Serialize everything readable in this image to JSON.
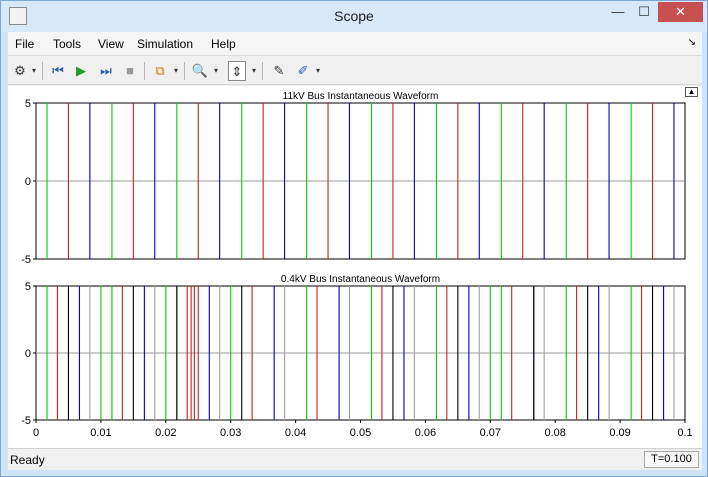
{
  "window": {
    "title": "Scope",
    "min_glyph": "—",
    "max_glyph": "☐",
    "close_glyph": "✕"
  },
  "menu": {
    "items": [
      "File",
      "Tools",
      "View",
      "Simulation",
      "Help"
    ],
    "arrow_glyph": "↘"
  },
  "toolbar": {
    "icons": [
      "gear-icon",
      "rewind-icon",
      "run-icon",
      "step-forward-icon",
      "stop-icon",
      "signal-select-icon",
      "zoom-icon",
      "scale-axes-icon",
      "highlight-icon",
      "edit-style-icon"
    ],
    "glyphs": {
      "gear": "⚙",
      "rewind": "⏮",
      "run": "▶",
      "step": "⏭",
      "stop": "■",
      "signal": "⧉",
      "zoom": "🔍",
      "scale": "⇕",
      "highlight": "✎",
      "edit": "✐",
      "drop": "▾"
    }
  },
  "status": {
    "left": "Ready",
    "right": "T=0.100"
  },
  "colors": {
    "blue": "#0000c8",
    "red": "#c8201a",
    "green": "#00d000",
    "gray": "#a0a0a0",
    "black": "#000000"
  },
  "chart_data": [
    {
      "type": "line",
      "title": "11kV Bus Instantaneous Waveform",
      "xlim": [
        0,
        0.1
      ],
      "ylim": [
        -5,
        5
      ],
      "yticks": [
        "5",
        "0",
        "-5"
      ],
      "xticks": [],
      "grid": "center-line",
      "series": [
        {
          "color": "green",
          "x": [
            0.0017,
            0.0117,
            0.0217,
            0.0317,
            0.0417,
            0.0517,
            0.0617,
            0.0717,
            0.0817,
            0.0917
          ]
        },
        {
          "color": "red",
          "x": [
            0.005,
            0.015,
            0.025,
            0.035,
            0.045,
            0.055,
            0.065,
            0.075,
            0.085,
            0.095
          ]
        },
        {
          "color": "blue",
          "x": [
            0.0083,
            0.0183,
            0.0283,
            0.0383,
            0.0483,
            0.0583,
            0.0683,
            0.0783,
            0.0883,
            0.0983
          ]
        }
      ]
    },
    {
      "type": "line",
      "title": "0.4kV Bus Instantaneous Waveform",
      "xlim": [
        0,
        0.1
      ],
      "ylim": [
        -5,
        5
      ],
      "yticks": [
        "5",
        "0",
        "-5"
      ],
      "xticks": [
        "0",
        "0.01",
        "0.02",
        "0.03",
        "0.04",
        "0.05",
        "0.06",
        "0.07",
        "0.08",
        "0.09",
        "0.1"
      ],
      "grid": "center-line",
      "series": [
        {
          "color": "green",
          "x": [
            0.0017,
            0.01,
            0.0117,
            0.02,
            0.0217,
            0.03,
            0.0417,
            0.0517,
            0.0617,
            0.07,
            0.0717,
            0.0817,
            0.0917
          ]
        },
        {
          "color": "red",
          "x": [
            0.0033,
            0.0133,
            0.0233,
            0.0239,
            0.0244,
            0.025,
            0.0333,
            0.0433,
            0.0533,
            0.0633,
            0.0733,
            0.0833,
            0.0933
          ]
        },
        {
          "color": "blue",
          "x": [
            0.0067,
            0.0167,
            0.0267,
            0.0367,
            0.0467,
            0.0567,
            0.0667,
            0.0767,
            0.0867,
            0.0967
          ]
        },
        {
          "color": "gray",
          "x": [
            0.0083,
            0.0183,
            0.0283,
            0.0383,
            0.0483,
            0.0583,
            0.0683,
            0.0783,
            0.0883,
            0.0983
          ]
        },
        {
          "color": "black",
          "x": [
            0.005,
            0.015,
            0.0217,
            0.0317,
            0.055,
            0.065,
            0.0767,
            0.085,
            0.095
          ]
        }
      ]
    }
  ]
}
